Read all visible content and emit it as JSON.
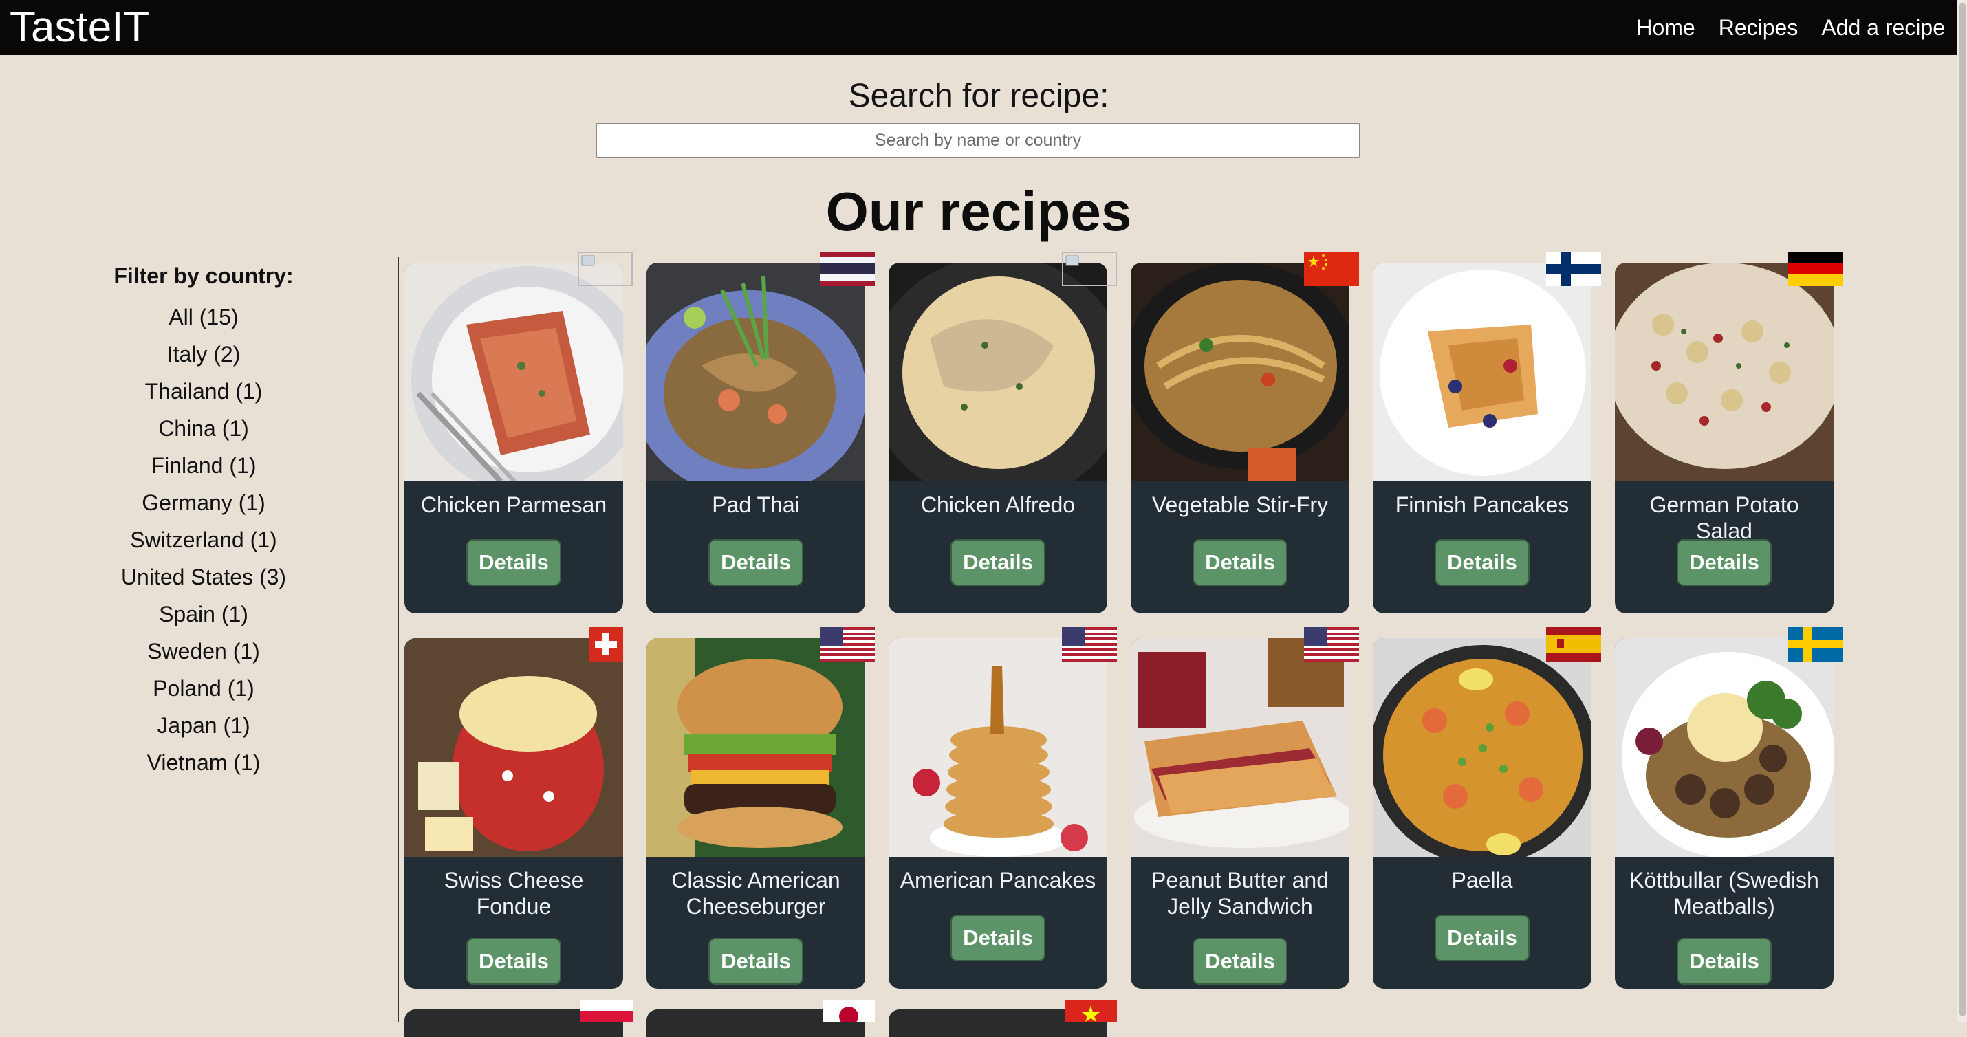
{
  "app": {
    "brand": "TasteIT"
  },
  "nav": {
    "links": [
      "Home",
      "Recipes",
      "Add a recipe"
    ]
  },
  "search": {
    "label": "Search for recipe:",
    "placeholder": "Search by name or country",
    "value": ""
  },
  "page_title": "Our recipes",
  "filters": {
    "heading": "Filter by country:",
    "items": [
      "All (15)",
      "Italy (2)",
      "Thailand (1)",
      "China (1)",
      "Finland (1)",
      "Germany (1)",
      "Switzerland (1)",
      "United States (3)",
      "Spain (1)",
      "Sweden (1)",
      "Poland (1)",
      "Japan (1)",
      "Vietnam (1)"
    ]
  },
  "recipes": [
    {
      "name": "Chicken Parmesan",
      "button": "Details",
      "flag": "broken-image-icon"
    },
    {
      "name": "Pad Thai",
      "button": "Details",
      "flag": "thailand-flag-icon"
    },
    {
      "name": "Chicken Alfredo",
      "button": "Details",
      "flag": "broken-image-icon"
    },
    {
      "name": "Vegetable Stir-Fry",
      "button": "Details",
      "flag": "china-flag-icon"
    },
    {
      "name": "Finnish Pancakes",
      "button": "Details",
      "flag": "finland-flag-icon"
    },
    {
      "name": "German Potato Salad",
      "button": "Details",
      "flag": "germany-flag-icon"
    },
    {
      "name": "Swiss Cheese Fondue",
      "button": "Details",
      "flag": "switzerland-flag-icon"
    },
    {
      "name": "Classic American Cheeseburger",
      "button": "Details",
      "flag": "usa-flag-icon"
    },
    {
      "name": "American Pancakes",
      "button": "Details",
      "flag": "usa-flag-icon"
    },
    {
      "name": "Peanut Butter and Jelly Sandwich",
      "button": "Details",
      "flag": "usa-flag-icon"
    },
    {
      "name": "Paella",
      "button": "Details",
      "flag": "spain-flag-icon"
    },
    {
      "name": "Köttbullar (Swedish Meatballs)",
      "button": "Details",
      "flag": "sweden-flag-icon"
    }
  ],
  "partial_row_flags": [
    "poland-flag-icon",
    "japan-flag-icon",
    "vietnam-flag-icon"
  ],
  "colors": {
    "background": "#e8dfd5",
    "navbar": "#0a0807",
    "card": "#222d35",
    "button": "#5c9467"
  }
}
